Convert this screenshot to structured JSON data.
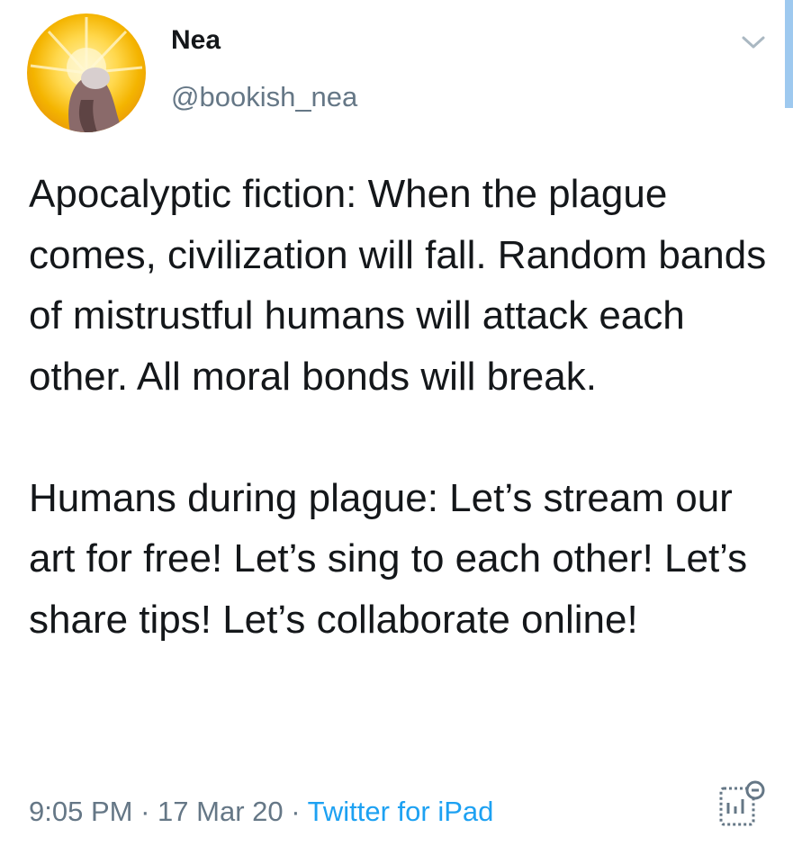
{
  "author": {
    "display_name": "Nea",
    "handle": "@bookish_nea",
    "avatar_icon": "avatar-image"
  },
  "tweet": {
    "paragraph_1": "Apocalyptic fiction: When the plague comes, civilization will fall.  Random bands of mistrustful humans will attack each other. All moral bonds will break.",
    "paragraph_2": "Humans during plague: Let’s stream our art for free! Let’s sing to each other! Let’s share tips! Let’s collaborate online!"
  },
  "meta": {
    "time": "9:05 PM",
    "separator": "·",
    "date": "17 Mar 20",
    "source": "Twitter for iPad"
  },
  "icons": {
    "menu": "chevron-down-icon",
    "analytics": "analytics-icon"
  },
  "colors": {
    "text": "#14171a",
    "secondary": "#657786",
    "link": "#1da1f2",
    "avatar_bg": "#f4b400"
  }
}
